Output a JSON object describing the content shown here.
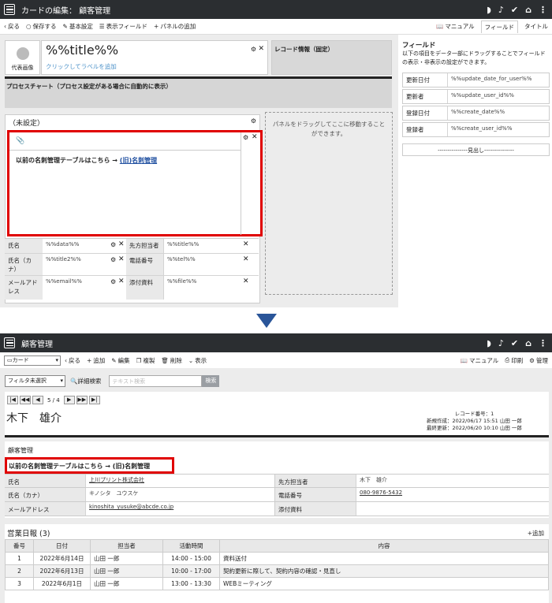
{
  "top": {
    "title": "カードの編集： 顧客管理",
    "toolbar": {
      "back": "戻る",
      "save": "保存する",
      "basic": "基本設定",
      "display_fields": "表示フィールド",
      "add_panel": "パネルの追加",
      "manual": "マニュアル",
      "tab_fields": "フィールド",
      "tab_title": "タイトル"
    },
    "rep_image": "代表画像",
    "title_field": "%%title%%",
    "add_label": "クリックしてラベルを追加",
    "record_info": "レコード情報（固定）",
    "process_chart": "プロセスチャート（プロセス設定がある場合に自動的に表示）",
    "unset": "（未設定）",
    "notice_prefix": "以前の名刺管理テーブルはこちら → ",
    "notice_link": "(旧)名刺管理",
    "drop_zone": "パネルをドラッグしてここに移動することができます。",
    "fields": [
      {
        "l1": "氏名",
        "v1": "%%data%%",
        "l2": "先方担当者",
        "v2": "%%title%%"
      },
      {
        "l1": "氏名（カナ）",
        "v1": "%%title2%%",
        "l2": "電話番号",
        "v2": "%%tel%%"
      },
      {
        "l1": "メールアドレス",
        "v1": "%%email%%",
        "l2": "添付資料",
        "v2": "%%file%%"
      }
    ],
    "sidebar": {
      "heading": "フィールド",
      "desc": "以下の項目をデータ一部にドラッグすることでフィールドの表示・非表示の設定ができます。",
      "rows": [
        {
          "l": "更新日付",
          "v": "%%update_date_for_user%%"
        },
        {
          "l": "更新者",
          "v": "%%update_user_id%%"
        },
        {
          "l": "登録日付",
          "v": "%%create_date%%"
        },
        {
          "l": "登録者",
          "v": "%%create_user_id%%"
        }
      ],
      "divider": "---------------見出し---------------"
    }
  },
  "bottom": {
    "title": "顧客管理",
    "view_select": "カード",
    "toolbar": {
      "back": "戻る",
      "add": "追加",
      "edit": "編集",
      "copy": "複製",
      "delete": "削除",
      "display": "表示",
      "manual": "マニュアル",
      "print": "印刷",
      "manage": "管理"
    },
    "filter": "フィルタ未選択",
    "adv_search": "詳細検索",
    "search_placeholder": "テキスト検索",
    "search_btn": "検索",
    "pager": "5 / 4",
    "name": "木下　雄介",
    "record_no": "レコード番号：1",
    "created": "新規作成：2022/06/17 15:51 山田 一郎",
    "updated": "最終更新：2022/06/20 10:10 山田 一郎",
    "section": "顧客管理",
    "notice_prefix": "以前の名刺管理テーブルはこちら → ",
    "notice_link": "(旧)名刺管理",
    "fields": [
      {
        "l1": "氏名",
        "v1": "上川プリント株式会社",
        "l2": "先方担当者",
        "v2": "木下　雄介"
      },
      {
        "l1": "氏名（カナ）",
        "v1": "キノシタ　ユウスケ",
        "l2": "電話番号",
        "v2": "080-9876-5432"
      },
      {
        "l1": "メールアドレス",
        "v1": "kinoshita_yusuke@abcde.co.jp",
        "l2": "添付資料",
        "v2": ""
      }
    ],
    "log_title": "営業日報 (3)",
    "log_add": "追加",
    "log_headers": [
      "番号",
      "日付",
      "担当者",
      "活動時間",
      "内容"
    ],
    "log_rows": [
      [
        "1",
        "2022年6月14日",
        "山田 一郎",
        "14:00 - 15:00",
        "資料送付"
      ],
      [
        "2",
        "2022年6月13日",
        "山田 一郎",
        "10:00 - 17:00",
        "契約更新に際して、契約内容の確認・見直し"
      ],
      [
        "3",
        "2022年6月1日",
        "山田 一郎",
        "13:00 - 13:30",
        "WEBミーティング"
      ]
    ]
  },
  "colors": {
    "header": "#2b2e31",
    "arrow": "#2a5599",
    "highlight": "#e00000"
  }
}
